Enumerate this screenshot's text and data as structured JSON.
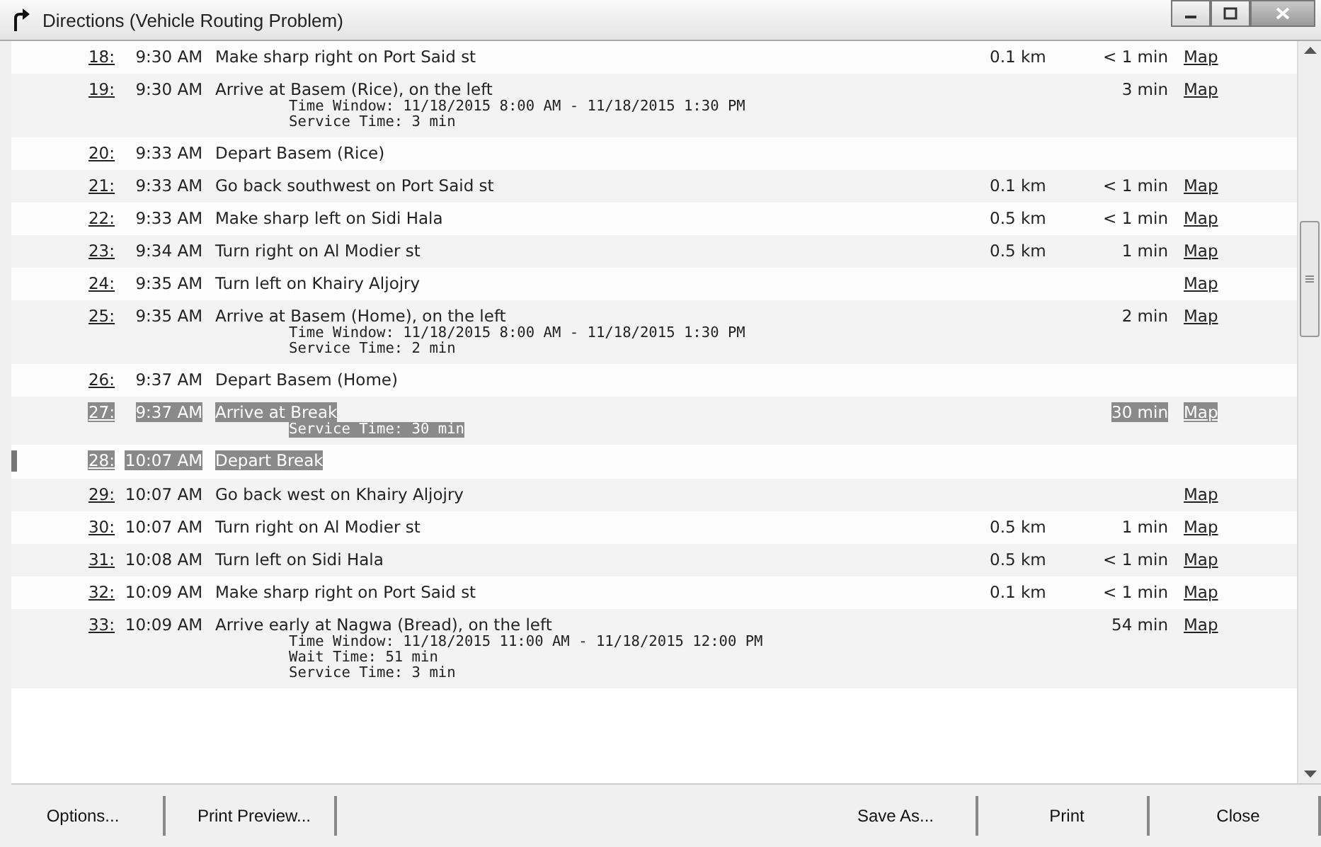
{
  "window": {
    "title": "Directions (Vehicle Routing Problem)"
  },
  "rows": [
    {
      "number": "18:",
      "time": "9:30 AM",
      "text": "Make sharp right on Port Said st",
      "details": [],
      "distance": "0.1 km",
      "duration": "< 1 min",
      "map": "Map",
      "selected": false,
      "focused": false
    },
    {
      "number": "19:",
      "time": "9:30 AM",
      "text": "Arrive at Basem (Rice), on the left",
      "details": [
        "Time Window: 11/18/2015 8:00 AM - 11/18/2015 1:30 PM",
        "Service Time: 3 min"
      ],
      "duration": "3 min",
      "map": "Map",
      "selected": false,
      "focused": false
    },
    {
      "number": "20:",
      "time": "9:33 AM",
      "text": "Depart Basem (Rice)",
      "details": [],
      "selected": false,
      "focused": false
    },
    {
      "number": "21:",
      "time": "9:33 AM",
      "text": "Go back southwest on Port Said st",
      "details": [],
      "distance": "0.1 km",
      "duration": "< 1 min",
      "map": "Map",
      "selected": false,
      "focused": false
    },
    {
      "number": "22:",
      "time": "9:33 AM",
      "text": "Make sharp left on Sidi Hala",
      "details": [],
      "distance": "0.5 km",
      "duration": "< 1 min",
      "map": "Map",
      "selected": false,
      "focused": false
    },
    {
      "number": "23:",
      "time": "9:34 AM",
      "text": "Turn right on Al Modier st",
      "details": [],
      "distance": "0.5 km",
      "duration": "1 min",
      "map": "Map",
      "selected": false,
      "focused": false
    },
    {
      "number": "24:",
      "time": "9:35 AM",
      "text": "Turn left on Khairy Aljojry",
      "details": [],
      "map": "Map",
      "selected": false,
      "focused": false
    },
    {
      "number": "25:",
      "time": "9:35 AM",
      "text": "Arrive at Basem (Home), on the left",
      "details": [
        "Time Window: 11/18/2015 8:00 AM - 11/18/2015 1:30 PM",
        "Service Time: 2 min"
      ],
      "duration": "2 min",
      "map": "Map",
      "selected": false,
      "focused": false
    },
    {
      "number": "26:",
      "time": "9:37 AM",
      "text": "Depart Basem (Home)",
      "details": [],
      "selected": false,
      "focused": false
    },
    {
      "number": "27:",
      "time": "9:37 AM",
      "text": "Arrive at Break",
      "details": [
        "Service Time: 30 min"
      ],
      "duration": "30 min",
      "map": "Map",
      "selected": true,
      "focused": false
    },
    {
      "number": "28:",
      "time": "10:07 AM",
      "text": "Depart Break",
      "details": [],
      "selected": true,
      "focused": true
    },
    {
      "number": "29:",
      "time": "10:07 AM",
      "text": "Go back west on Khairy Aljojry",
      "details": [],
      "map": "Map",
      "selected": false,
      "focused": false
    },
    {
      "number": "30:",
      "time": "10:07 AM",
      "text": "Turn right on Al Modier st",
      "details": [],
      "distance": "0.5 km",
      "duration": "1 min",
      "map": "Map",
      "selected": false,
      "focused": false
    },
    {
      "number": "31:",
      "time": "10:08 AM",
      "text": "Turn left on Sidi Hala",
      "details": [],
      "distance": "0.5 km",
      "duration": "< 1 min",
      "map": "Map",
      "selected": false,
      "focused": false
    },
    {
      "number": "32:",
      "time": "10:09 AM",
      "text": "Make sharp right on Port Said st",
      "details": [],
      "distance": "0.1 km",
      "duration": "< 1 min",
      "map": "Map",
      "selected": false,
      "focused": false
    },
    {
      "number": "33:",
      "time": "10:09 AM",
      "text": "Arrive early at Nagwa (Bread), on the left",
      "details": [
        "Time Window: 11/18/2015 11:00 AM - 11/18/2015 12:00 PM",
        "Wait Time: 51 min",
        "Service Time: 3 min"
      ],
      "duration": "54 min",
      "map": "Map",
      "selected": false,
      "focused": false
    }
  ],
  "buttons_left": [
    "Options...",
    "Print Preview..."
  ],
  "buttons_right": [
    "Save As...",
    "Print",
    "Close"
  ]
}
